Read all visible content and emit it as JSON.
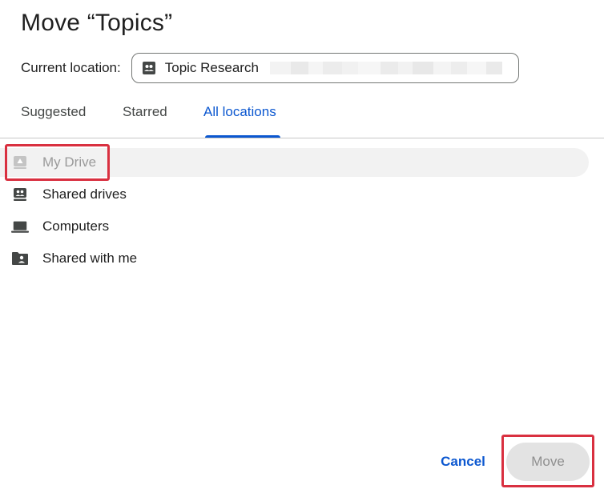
{
  "dialog": {
    "title": "Move “Topics”"
  },
  "location": {
    "label": "Current location:",
    "value": "Topic Research",
    "icon": "shared-drive-icon"
  },
  "tabs": [
    {
      "label": "Suggested",
      "active": false
    },
    {
      "label": "Starred",
      "active": false
    },
    {
      "label": "All locations",
      "active": true
    }
  ],
  "locations": [
    {
      "label": "My Drive",
      "icon": "my-drive-icon",
      "selected": true
    },
    {
      "label": "Shared drives",
      "icon": "shared-drives-icon",
      "selected": false
    },
    {
      "label": "Computers",
      "icon": "computer-icon",
      "selected": false
    },
    {
      "label": "Shared with me",
      "icon": "shared-with-me-icon",
      "selected": false
    }
  ],
  "actions": {
    "cancel_label": "Cancel",
    "move_label": "Move",
    "move_disabled": true
  },
  "colors": {
    "accent": "#0b57d0",
    "highlight": "#d93040",
    "selected_bg": "#f2f2f2"
  }
}
